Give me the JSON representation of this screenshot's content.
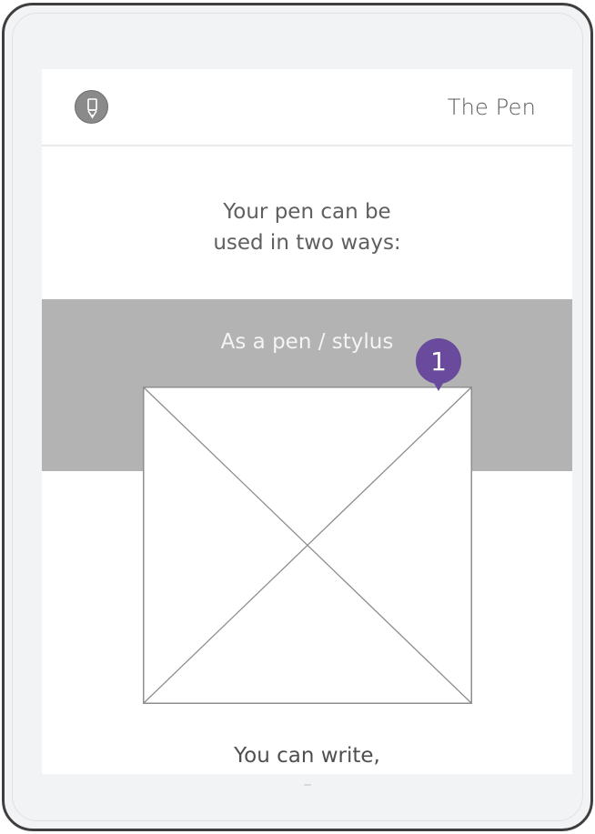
{
  "header": {
    "title": "The Pen",
    "logo_icon": "pen-icon"
  },
  "intro": {
    "line1": "Your pen can be",
    "line2": "used in two ways:"
  },
  "section": {
    "title": "As a pen / stylus",
    "band_color": "#b3b3b3"
  },
  "marker": {
    "number": "1",
    "color": "#6a4a9c"
  },
  "body": {
    "text": "You can write,"
  }
}
